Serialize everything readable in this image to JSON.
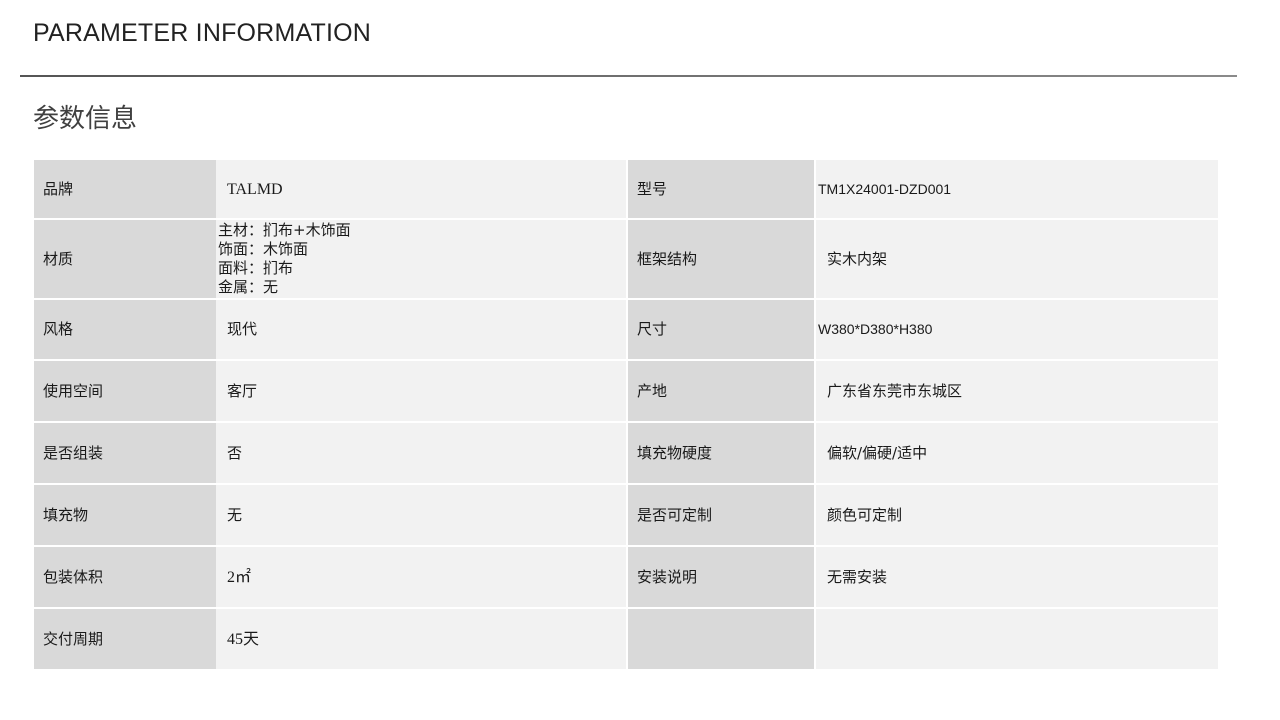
{
  "header": {
    "title_en": "PARAMETER INFORMATION",
    "title_cn": "参数信息"
  },
  "params": {
    "brand_label": "品牌",
    "brand_value": "TALMD",
    "model_label": "型号",
    "model_value": "TM1X24001-DZD001",
    "material_label": "材质",
    "material_lines": [
      "主材：扪布+木饰面",
      "饰面：木饰面",
      "面料：扪布",
      "金属：无"
    ],
    "frame_label": "框架结构",
    "frame_value": "实木内架",
    "style_label": "风格",
    "style_value": "现代",
    "size_label": "尺寸",
    "size_value": "W380*D380*H380",
    "space_label": "使用空间",
    "space_value": "客厅",
    "origin_label": "产地",
    "origin_value": "广东省东莞市东城区",
    "assembly_label": "是否组装",
    "assembly_value": "否",
    "hardness_label": "填充物硬度",
    "hardness_value": "偏软/偏硬/适中",
    "filling_label": "填充物",
    "filling_value": "无",
    "custom_label": "是否可定制",
    "custom_value": "颜色可定制",
    "volume_label": "包装体积",
    "volume_value": "2㎡",
    "install_label": "安装说明",
    "install_value": "无需安装",
    "delivery_label": "交付周期",
    "delivery_value": "45天"
  }
}
